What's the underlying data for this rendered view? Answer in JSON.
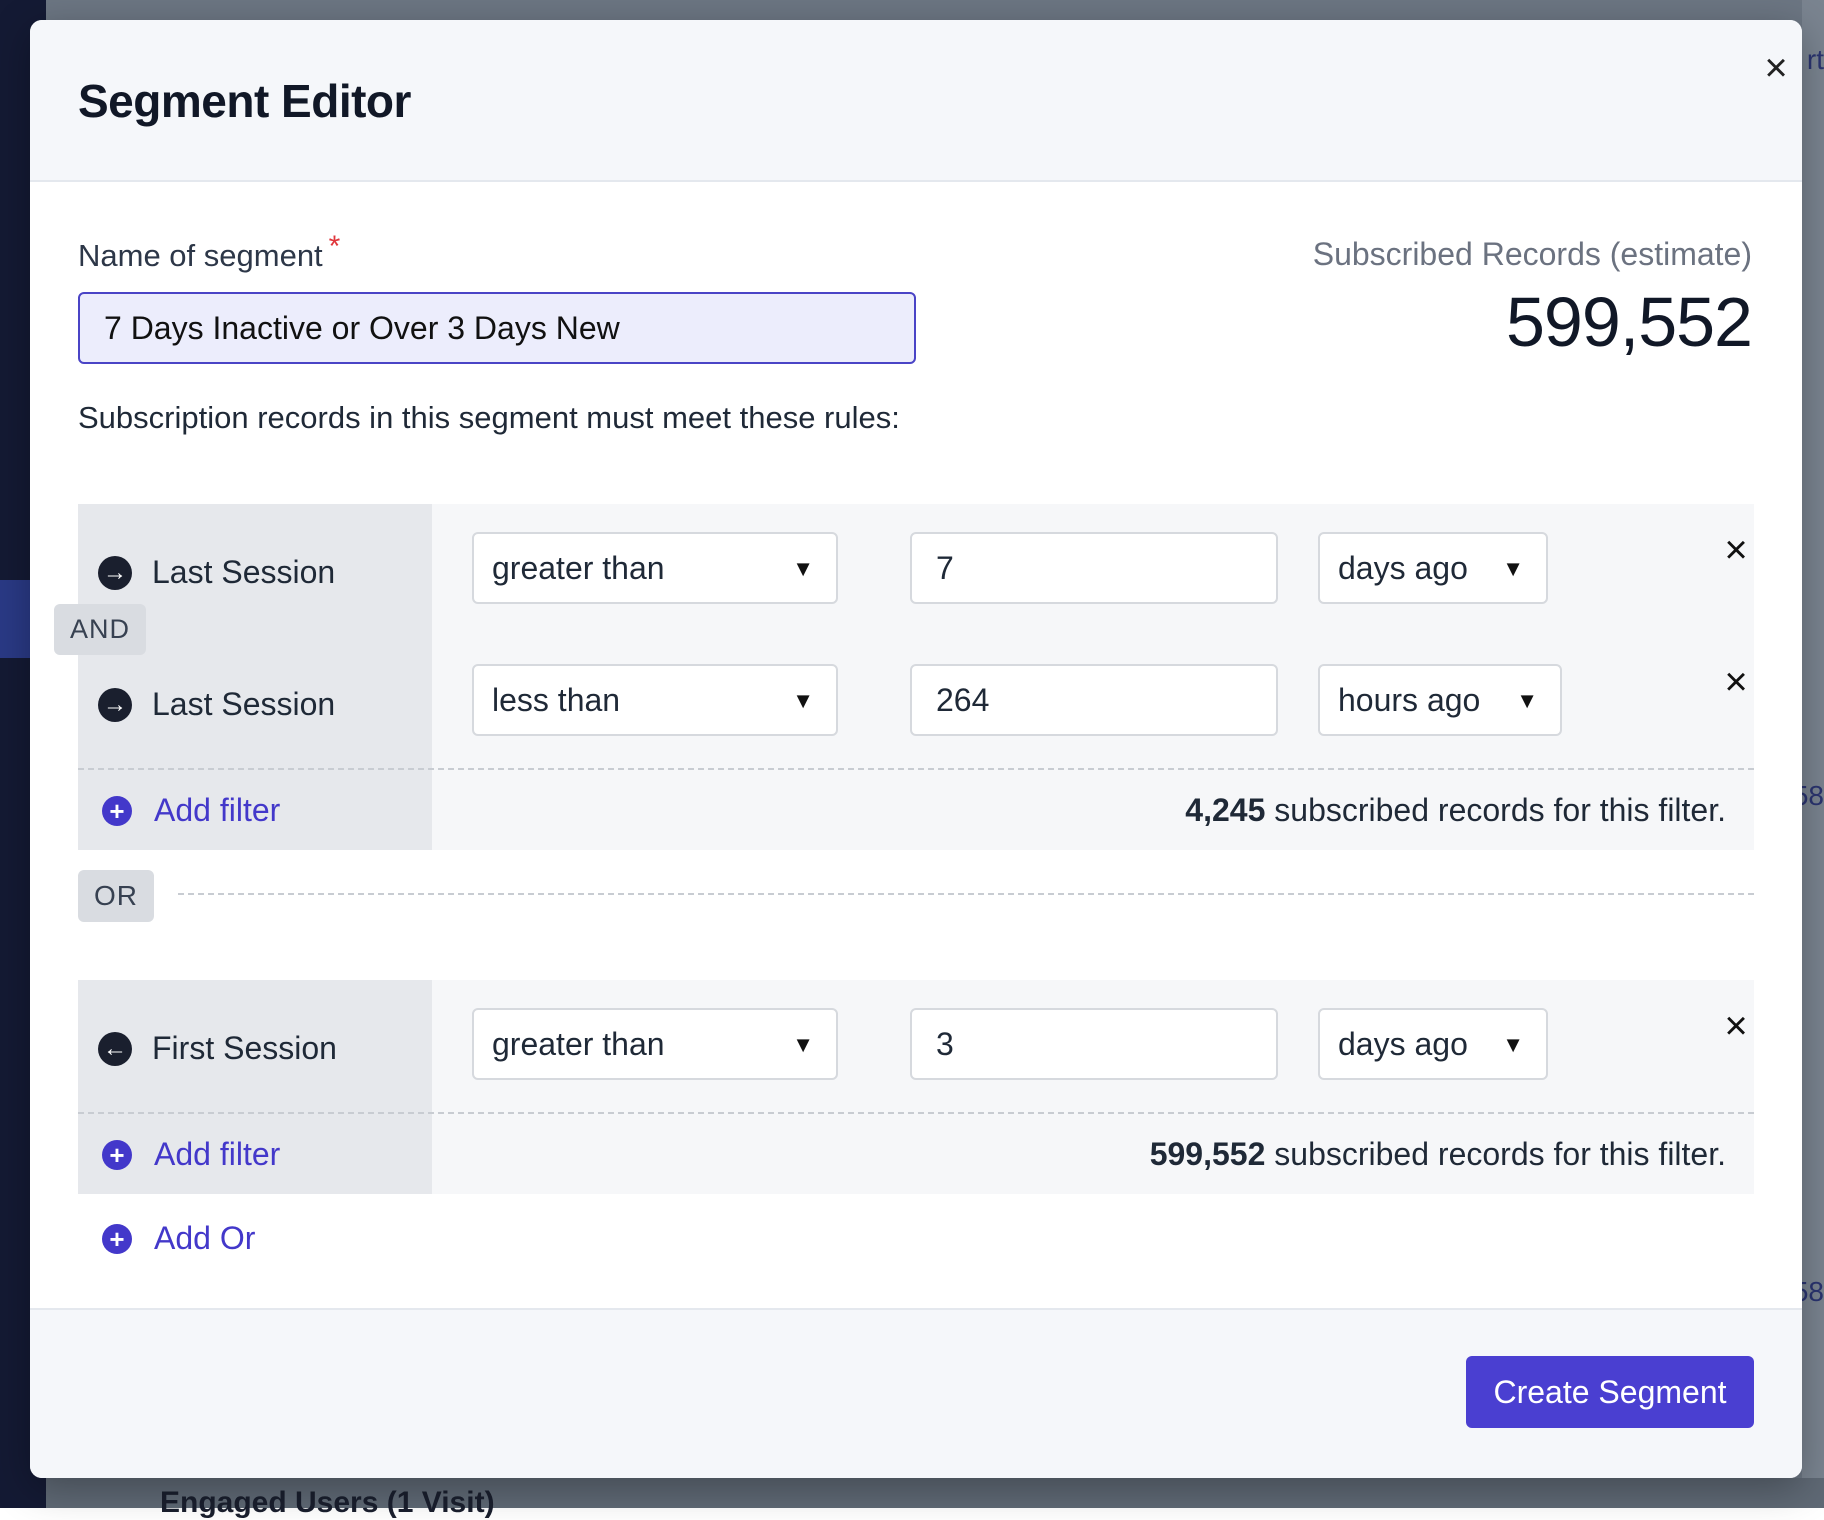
{
  "modal": {
    "title": "Segment Editor"
  },
  "segment": {
    "name_label": "Name of segment",
    "required_mark": "*",
    "name_value": "7 Days Inactive or Over 3 Days New",
    "estimate_label": "Subscribed Records (estimate)",
    "estimate_value": "599,552",
    "rules_intro": "Subscription records in this segment must meet these rules:"
  },
  "groups": [
    {
      "rows": [
        {
          "field": "Last Session",
          "operator": "greater than",
          "value": "7",
          "unit": "days ago"
        },
        {
          "field": "Last Session",
          "operator": "less than",
          "value": "264",
          "unit": "hours ago"
        }
      ],
      "connector": "AND",
      "add_filter_label": "Add filter",
      "count_value": "4,245",
      "count_suffix": " subscribed records for this filter."
    },
    {
      "rows": [
        {
          "field": "First Session",
          "operator": "greater than",
          "value": "3",
          "unit": "days ago"
        }
      ],
      "add_filter_label": "Add filter",
      "count_value": "599,552",
      "count_suffix": " subscribed records for this filter."
    }
  ],
  "or_label": "OR",
  "add_or_label": "Add Or",
  "footer": {
    "create_label": "Create Segment"
  },
  "background": {
    "edge_text_top": "rt",
    "edge_text_mid": "58",
    "edge_text_low": "58",
    "bottom_text": "Engaged Users (1 Visit)"
  },
  "colors": {
    "accent": "#4a3fd1",
    "link": "#4338ca",
    "required": "#e0363c"
  }
}
